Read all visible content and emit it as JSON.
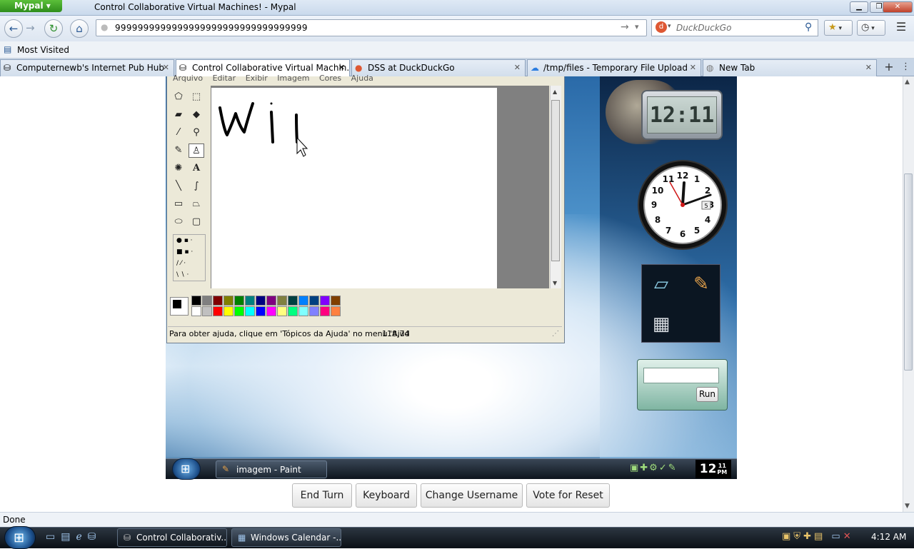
{
  "browser": {
    "app_menu": "Mypal",
    "window_title": "Control Collaborative Virtual Machines! - Mypal",
    "url": "9999999999999999999999999999999999",
    "search_placeholder": "DuckDuckGo",
    "bookmark": "Most Visited",
    "status": "Done",
    "tabs": [
      {
        "label": "Computernewb's Internet Pub Hub",
        "active": false
      },
      {
        "label": "Control Collaborative Virtual Machin...",
        "active": true
      },
      {
        "label": "DSS at DuckDuckGo",
        "active": false
      },
      {
        "label": "/tmp/files - Temporary File Upload",
        "active": false
      },
      {
        "label": "New Tab",
        "active": false
      }
    ]
  },
  "paint": {
    "menu": [
      "Arquivo",
      "Editar",
      "Exibir",
      "Imagem",
      "Cores",
      "Ajuda"
    ],
    "status_text": "Para obter ajuda, clique em 'Tópicos da Ajuda' no menu 'Ajud",
    "coords": "118,74",
    "palette_top": [
      "#000000",
      "#808080",
      "#800000",
      "#808000",
      "#008000",
      "#008080",
      "#000080",
      "#800080",
      "#808040",
      "#004040",
      "#0080ff",
      "#004080",
      "#8000ff",
      "#804000"
    ],
    "palette_bottom": [
      "#ffffff",
      "#c0c0c0",
      "#ff0000",
      "#ffff00",
      "#00ff00",
      "#00ffff",
      "#0000ff",
      "#ff00ff",
      "#ffff80",
      "#00ff80",
      "#80ffff",
      "#8080ff",
      "#ff0080",
      "#ff8040"
    ]
  },
  "vm": {
    "digital_clock": "12:11",
    "run_button": "Run",
    "taskbar_item": "imagem - Paint",
    "time_hour": "12",
    "time_min": "11",
    "time_ampm": "PM",
    "calendar_day": "5"
  },
  "controls": {
    "end_turn": "End Turn",
    "keyboard": "Keyboard",
    "change_username": "Change Username",
    "vote_reset": "Vote for Reset"
  },
  "host": {
    "tasks": [
      {
        "label": "Control Collaborativ...",
        "active": true
      },
      {
        "label": "Windows Calendar -...",
        "active": false
      }
    ],
    "time": "4:12 AM"
  }
}
